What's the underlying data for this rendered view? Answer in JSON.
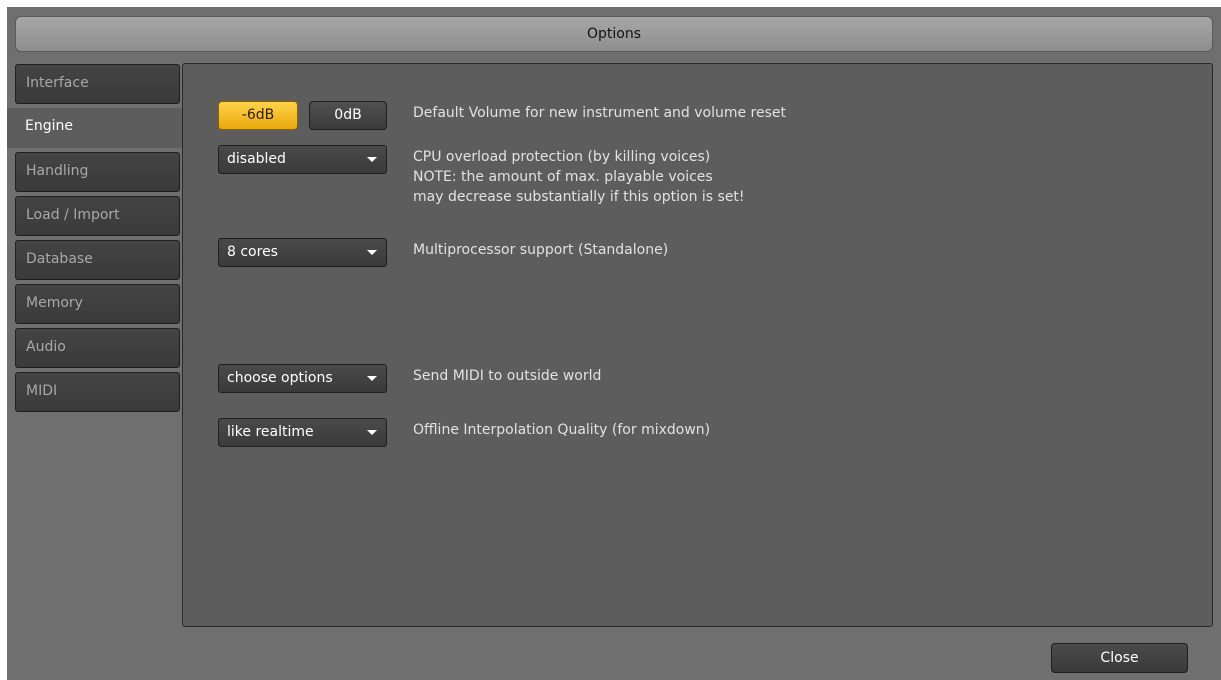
{
  "window": {
    "title": "Options"
  },
  "tabs": [
    {
      "label": "Interface",
      "active": false
    },
    {
      "label": "Engine",
      "active": true
    },
    {
      "label": "Handling",
      "active": false
    },
    {
      "label": "Load / Import",
      "active": false
    },
    {
      "label": "Database",
      "active": false
    },
    {
      "label": "Memory",
      "active": false
    },
    {
      "label": "Audio",
      "active": false
    },
    {
      "label": "MIDI",
      "active": false
    }
  ],
  "engine": {
    "volume": {
      "options": [
        "-6dB",
        "0dB"
      ],
      "selected": "-6dB",
      "description": "Default Volume for new instrument and volume reset"
    },
    "cpu_protection": {
      "value": "disabled",
      "description_lines": [
        "CPU overload protection (by killing voices)",
        "NOTE: the amount of max. playable voices",
        "may decrease substantially if this option is set!"
      ]
    },
    "multiprocessor": {
      "value": "8 cores",
      "description": "Multiprocessor support  (Standalone)"
    },
    "midi_out": {
      "value": "choose options",
      "description": "Send MIDI to outside world"
    },
    "offline_interpolation": {
      "value": "like realtime",
      "description": "Offline Interpolation Quality (for mixdown)"
    }
  },
  "footer": {
    "close_label": "Close"
  },
  "colors": {
    "accent_active": "#f5be1e",
    "panel": "#5d5d5d",
    "window": "#6f6f6f"
  },
  "icons": {
    "dropdown": "chevron-down-icon"
  }
}
